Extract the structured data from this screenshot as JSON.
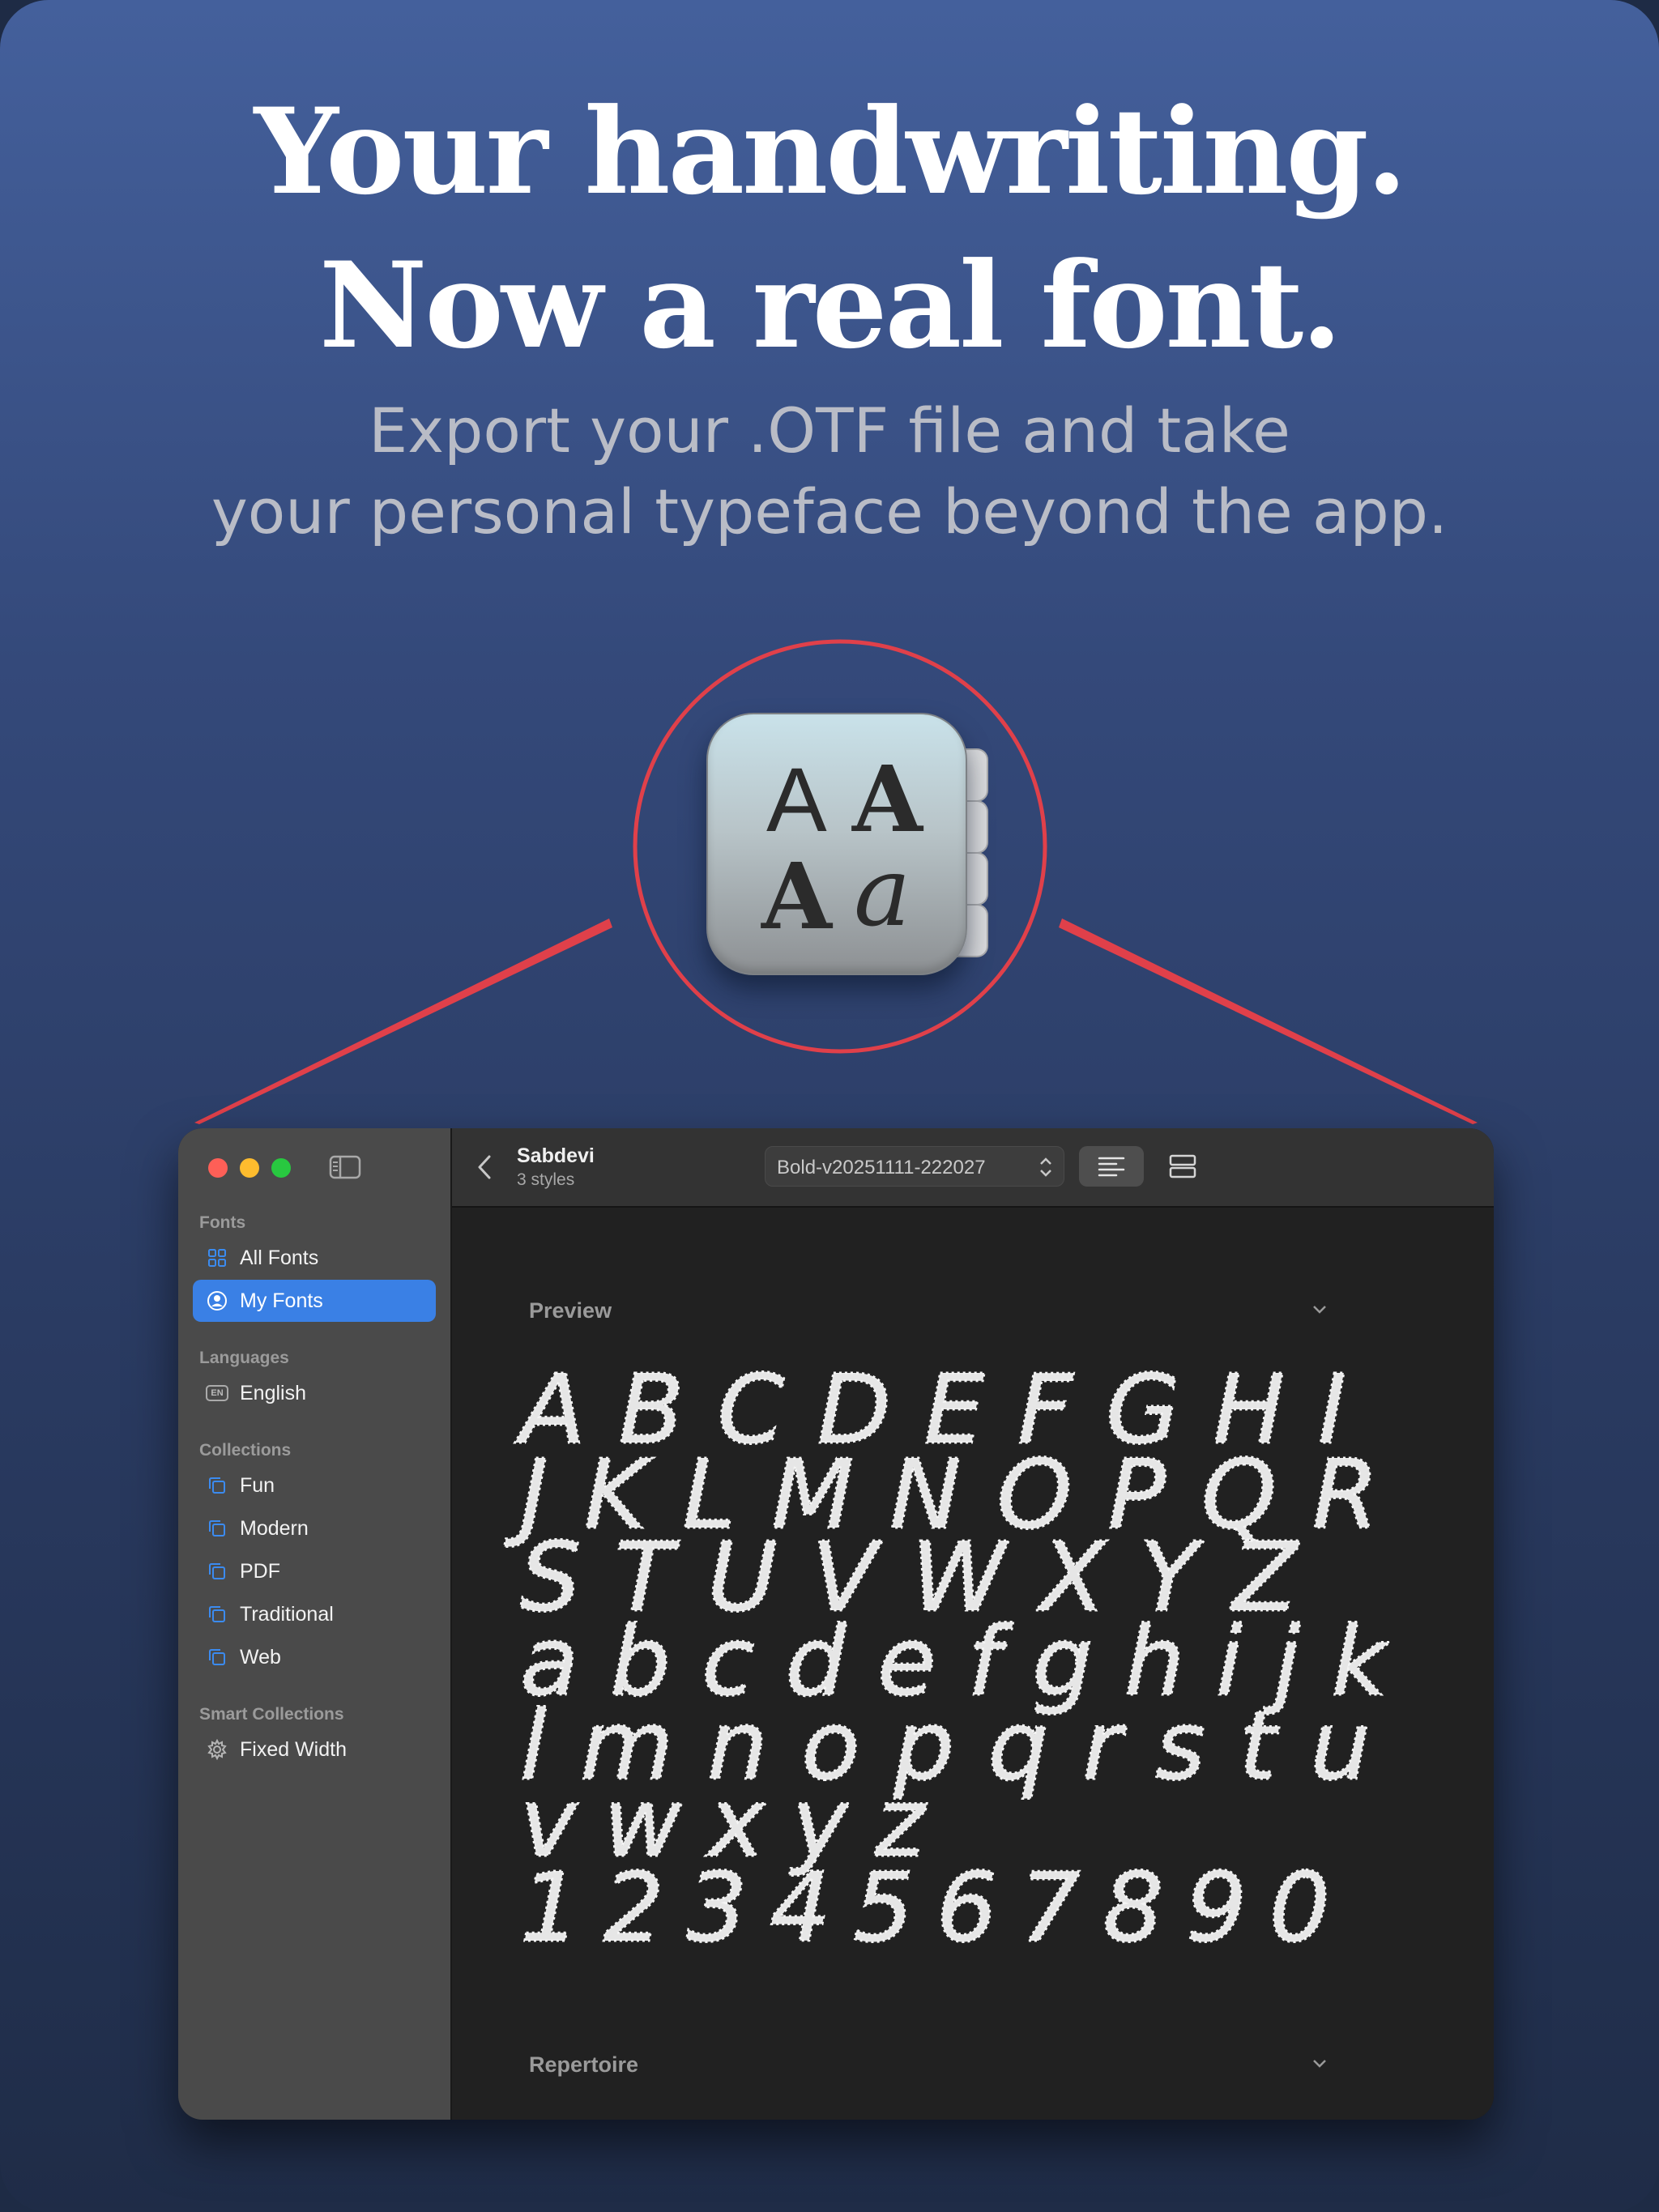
{
  "promo": {
    "headline_line1": "Your handwriting.",
    "headline_line2": "Now a real font.",
    "subline_line1": "Export your .OTF file and take",
    "subline_line2": "your personal typeface beyond the app."
  },
  "colors": {
    "highlight_ring": "#e0404a",
    "sidebar_active": "#3a80e5",
    "window_bg": "#212121",
    "sidebar_bg": "#4a4a4a"
  },
  "app_icon": {
    "name": "font-book-icon",
    "glyphs": [
      "A",
      "A",
      "A",
      "a"
    ]
  },
  "window": {
    "sidebar": {
      "sections": [
        {
          "label": "Fonts",
          "items": [
            {
              "label": "All Fonts",
              "icon": "grid-icon"
            },
            {
              "label": "My Fonts",
              "icon": "person-circle-icon",
              "active": true
            }
          ]
        },
        {
          "label": "Languages",
          "items": [
            {
              "label": "English",
              "icon": "en-badge-icon",
              "badge": "EN"
            }
          ]
        },
        {
          "label": "Collections",
          "items": [
            {
              "label": "Fun",
              "icon": "collection-icon"
            },
            {
              "label": "Modern",
              "icon": "collection-icon"
            },
            {
              "label": "PDF",
              "icon": "collection-icon"
            },
            {
              "label": "Traditional",
              "icon": "collection-icon"
            },
            {
              "label": "Web",
              "icon": "collection-icon"
            }
          ]
        },
        {
          "label": "Smart Collections",
          "items": [
            {
              "label": "Fixed Width",
              "icon": "gear-icon"
            }
          ]
        }
      ]
    },
    "toolbar": {
      "family_name": "Sabdevi",
      "family_styles": "3 styles",
      "style_select_value": "Bold-v20251111-222027"
    },
    "content": {
      "preview_label": "Preview",
      "repertoire_label": "Repertoire",
      "preview_lines": [
        "A B C D E F G H I",
        "J K L M N O P Q R",
        "S T U V W X Y Z",
        "a b c d e f g h i j k",
        "l m n o p q r s t u",
        "v w x y z",
        "1 2 3 4 5 6 7 8 9 0"
      ]
    }
  }
}
